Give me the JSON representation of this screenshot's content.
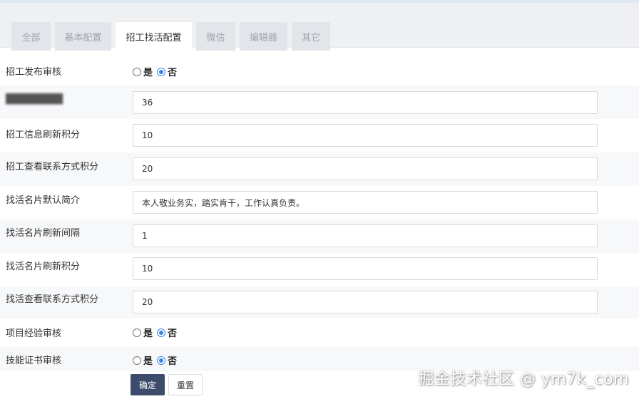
{
  "tabs": [
    {
      "label": "全部",
      "active": false
    },
    {
      "label": "基本配置",
      "active": false
    },
    {
      "label": "招工找活配置",
      "active": true
    },
    {
      "label": "微信",
      "active": false
    },
    {
      "label": "编辑器",
      "active": false
    },
    {
      "label": "其它",
      "active": false
    }
  ],
  "form": {
    "recruit_publish_review": {
      "label": "招工发布审核",
      "options": [
        "是",
        "否"
      ],
      "selected": "否"
    },
    "blurred_row": {
      "label": "████████",
      "value": "36"
    },
    "recruit_refresh_points": {
      "label": "招工信息刷新积分",
      "value": "10"
    },
    "recruit_view_contact_points": {
      "label": "招工查看联系方式积分",
      "value": "20"
    },
    "card_default_intro": {
      "label": "找活名片默认简介",
      "value": "本人敬业务实，踏实肯干，工作认真负责。"
    },
    "card_refresh_interval": {
      "label": "找活名片刷新间隔",
      "value": "1"
    },
    "card_refresh_points": {
      "label": "找活名片刷新积分",
      "value": "10"
    },
    "card_view_contact_points": {
      "label": "找活查看联系方式积分",
      "value": "20"
    },
    "project_experience_review": {
      "label": "项目经验审核",
      "options": [
        "是",
        "否"
      ],
      "selected": "否"
    },
    "skill_cert_review": {
      "label": "技能证书审核",
      "options": [
        "是",
        "否"
      ],
      "selected": "否"
    }
  },
  "buttons": {
    "confirm": "确定",
    "reset": "重置"
  },
  "watermark": "掘金技术社区 @ ym7k_com",
  "colors": {
    "accent": "#3b83e6",
    "primary_button": "#3d4c6c",
    "tab_bar": "#eef0f2"
  }
}
